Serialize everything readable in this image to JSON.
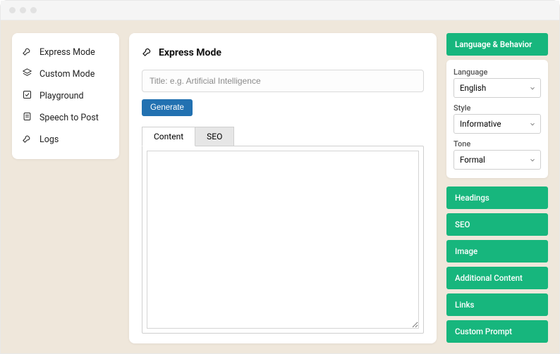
{
  "sidebar": {
    "items": [
      {
        "label": "Express Mode",
        "icon": "wrench"
      },
      {
        "label": "Custom Mode",
        "icon": "layers"
      },
      {
        "label": "Playground",
        "icon": "checkbox"
      },
      {
        "label": "Speech to Post",
        "icon": "document"
      },
      {
        "label": "Logs",
        "icon": "wrench"
      }
    ]
  },
  "main": {
    "title": "Express Mode",
    "title_input_placeholder": "Title: e.g. Artificial Intelligence",
    "generate_label": "Generate",
    "tabs": [
      {
        "label": "Content",
        "active": true
      },
      {
        "label": "SEO",
        "active": false
      }
    ]
  },
  "right": {
    "lang_behavior": {
      "header": "Language & Behavior",
      "fields": {
        "language_label": "Language",
        "language_value": "English",
        "style_label": "Style",
        "style_value": "Informative",
        "tone_label": "Tone",
        "tone_value": "Formal"
      }
    },
    "panels": [
      {
        "label": "Headings"
      },
      {
        "label": "SEO"
      },
      {
        "label": "Image"
      },
      {
        "label": "Additional Content"
      },
      {
        "label": "Links"
      },
      {
        "label": "Custom Prompt"
      }
    ]
  }
}
